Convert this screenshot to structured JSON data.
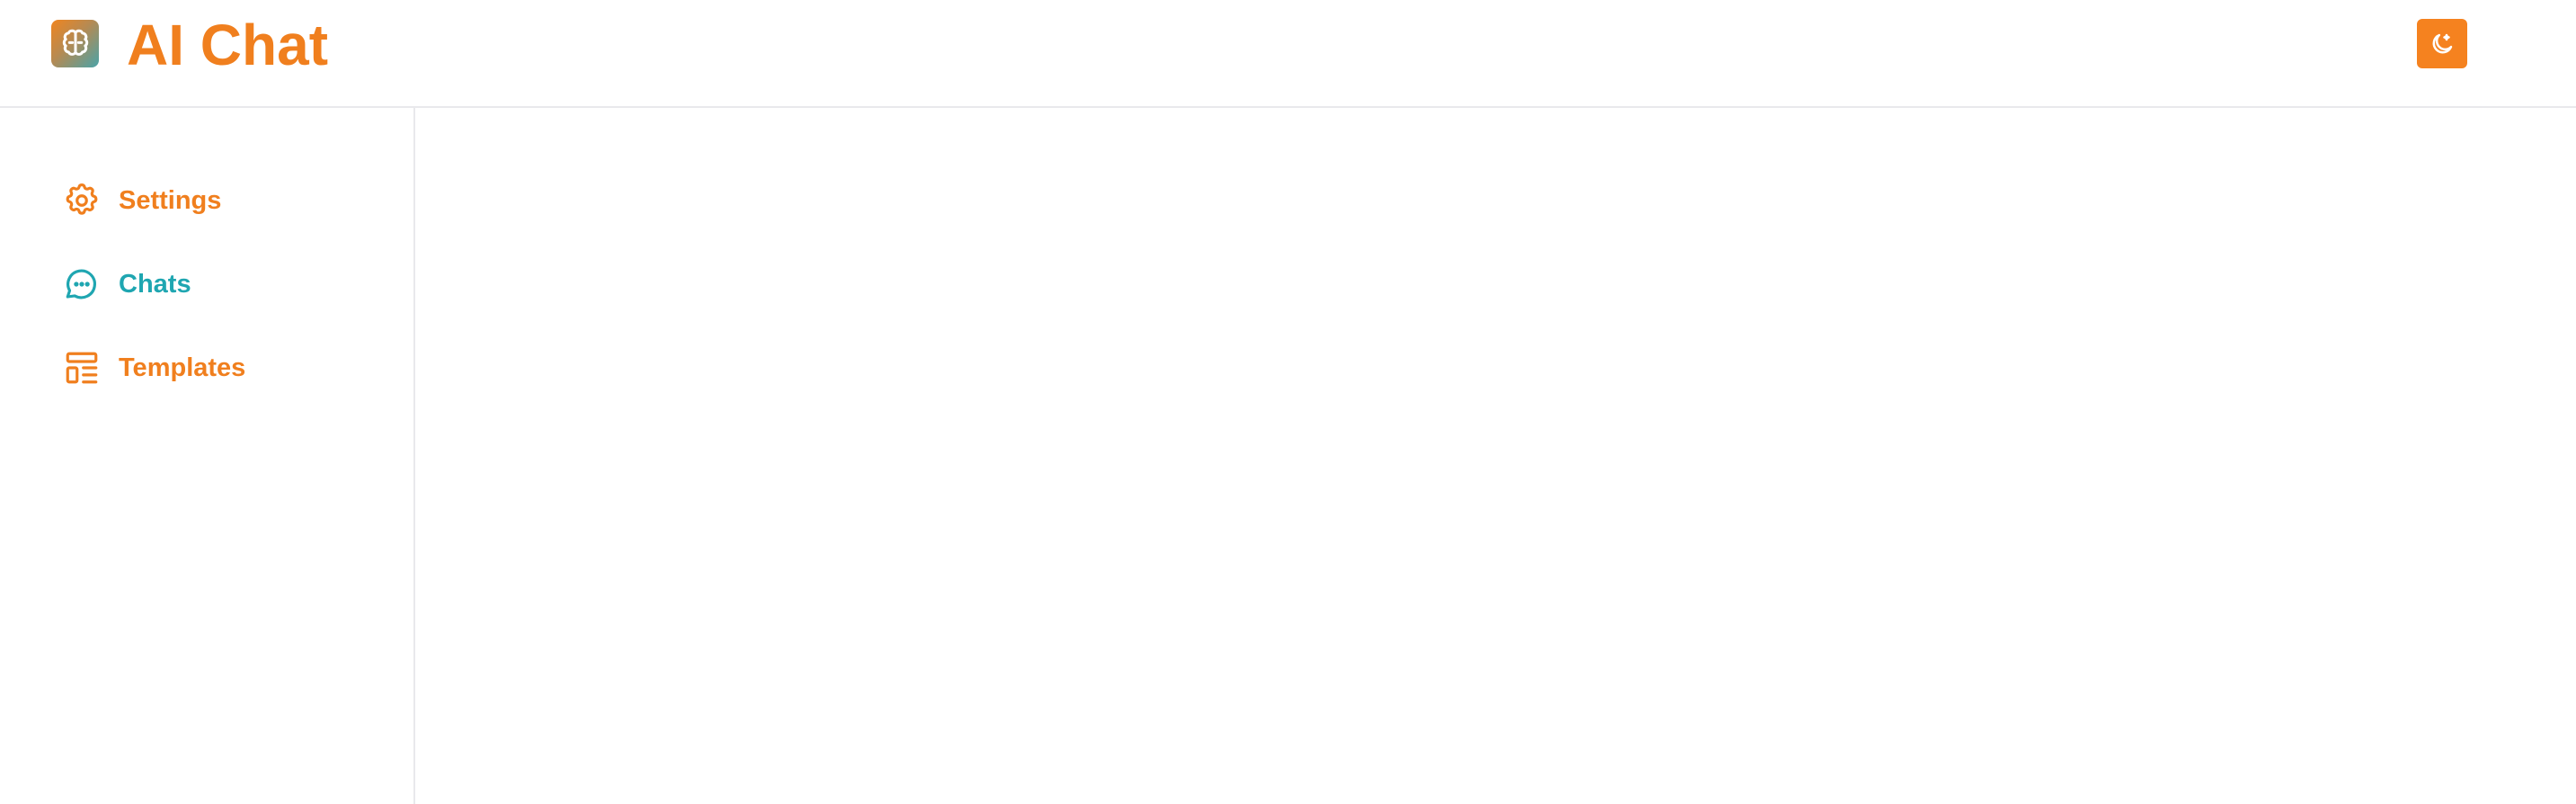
{
  "app": {
    "title": "AI Chat",
    "logo_icon": "brain-icon"
  },
  "header": {
    "theme_toggle_icon": "moon-icon"
  },
  "sidebar": {
    "items": [
      {
        "label": "Settings",
        "icon": "gear-icon",
        "color": "#f07f1e",
        "active": false
      },
      {
        "label": "Chats",
        "icon": "chat-bubble-icon",
        "color": "#1fa6b1",
        "active": true
      },
      {
        "label": "Templates",
        "icon": "template-icon",
        "color": "#f07f1e",
        "active": false
      }
    ]
  },
  "colors": {
    "accent": "#f07f1e",
    "active": "#1fa6b1",
    "divider": "#e9e9ec",
    "background": "#ffffff"
  }
}
